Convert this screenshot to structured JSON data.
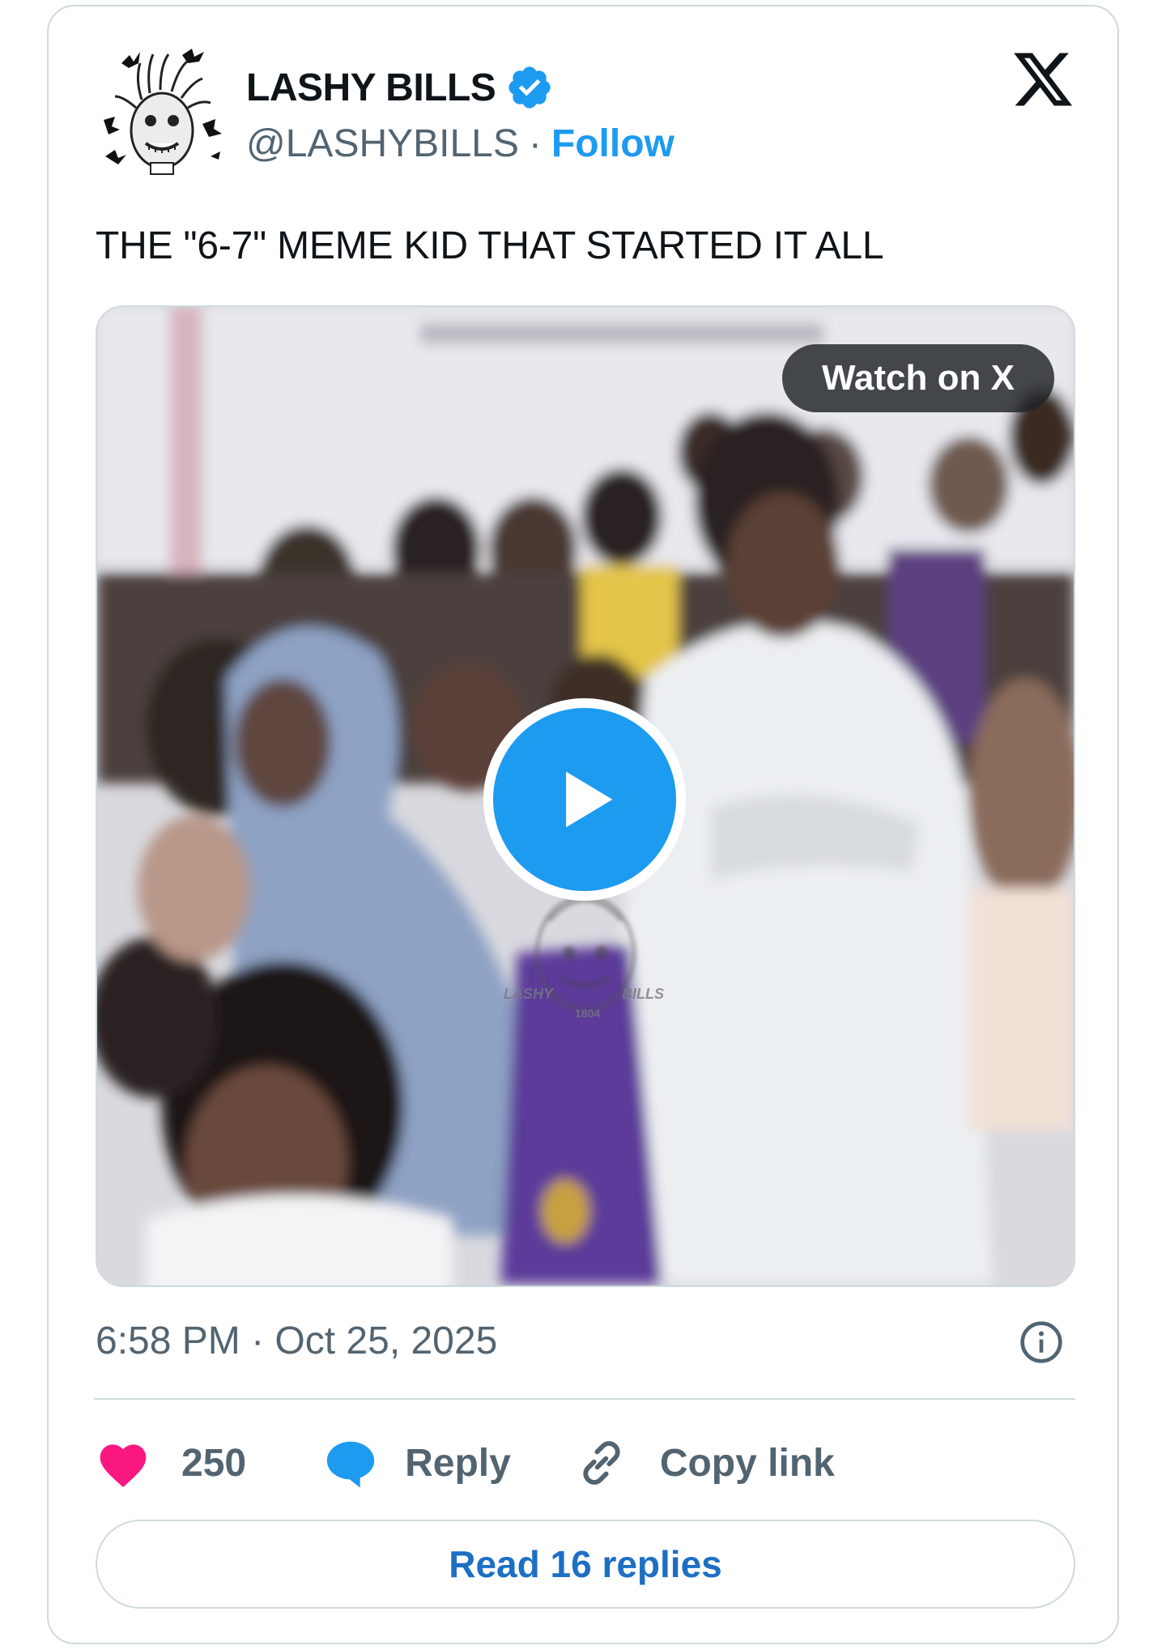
{
  "author": {
    "name": "LASHY BILLS",
    "handle": "@LASHYBILLS",
    "separator": "·",
    "follow_label": "Follow",
    "verified": true
  },
  "tweet": {
    "text": "THE \"6-7\" MEME KID THAT STARTED IT ALL",
    "timestamp": "6:58 PM · Oct 25, 2025"
  },
  "media": {
    "watch_label": "Watch on X",
    "watermark_left": "LASHY",
    "watermark_right": "BILLS",
    "watermark_number": "1804"
  },
  "actions": {
    "likes": "250",
    "reply_label": "Reply",
    "copy_label": "Copy link"
  },
  "read_replies_label": "Read 16 replies",
  "colors": {
    "accent": "#1d9bf0",
    "like": "#f91880",
    "muted": "#536471",
    "border": "#cfd9de"
  },
  "icons": [
    "verified-badge-icon",
    "x-logo-icon",
    "play-icon",
    "info-icon",
    "heart-icon",
    "reply-bubble-icon",
    "link-icon"
  ]
}
